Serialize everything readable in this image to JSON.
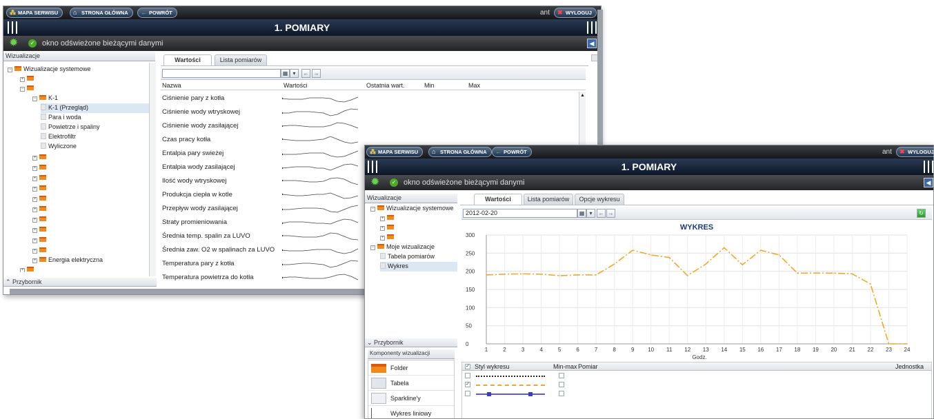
{
  "topnav": {
    "map": "MAPA SERWISU",
    "home": "STRONA GŁÓWNA",
    "back": "POWRÓT",
    "user": "ant",
    "logout": "WYLOGUJ"
  },
  "title": "1. POMIARY",
  "status": "okno odświeżone bieżącymi danymi",
  "left_panel": {
    "header": "Wizualizacje",
    "tree": {
      "system": "Wizualizacje systemowe",
      "k1": "K-1",
      "k1_children": [
        "K-1 (Przegląd)",
        "Para i woda",
        "Powietrze i spaliny",
        "Elektrofiltr",
        "Wyliczone"
      ],
      "energy": "Energia elektryczna",
      "mine": "Moje wizualizacje",
      "mine_children": [
        "Tabela pomiarów",
        "Wykres"
      ]
    },
    "toolbox": "Przybornik",
    "components_header": "Komponenty wizualizacji",
    "components": [
      "Folder",
      "Tabela",
      "Sparkline'y",
      "Wykres liniowy"
    ]
  },
  "tabs": {
    "values": "Wartości",
    "list": "Lista pomiarów",
    "options": "Opcje wykresu"
  },
  "measure_table": {
    "columns": [
      "Nazwa",
      "Wartości",
      "Ostatnia wart.",
      "Min",
      "Max"
    ],
    "rows": [
      "Ciśnienie pary z kotła",
      "Ciśnienie wody wtryskowej",
      "Ciśnienie wody zasilającej",
      "Czas pracy kotła",
      "Entalpia pary swieżej",
      "Entalpia wody zasilającej",
      "Ilość wody wtryskowej",
      "Produkcja ciepła w kotle",
      "Przepływ wody zasilającej",
      "Straty promieniowania",
      "Średnia temp. spalin za LUVO",
      "Średnia zaw. O2 w spalinach za LUVO",
      "Temperatura pary z kotła",
      "Temperatura powietrza do kotła"
    ]
  },
  "date_value": "2012-02-20",
  "chart_data": {
    "type": "line",
    "title": "WYKRES",
    "xlabel": "Godz.",
    "ylabel": "",
    "x": [
      1,
      2,
      3,
      4,
      5,
      6,
      7,
      8,
      9,
      10,
      11,
      12,
      13,
      14,
      15,
      16,
      17,
      18,
      19,
      20,
      21,
      22,
      23,
      24
    ],
    "series": [
      {
        "values": [
          190,
          192,
          193,
          192,
          188,
          190,
          190,
          220,
          258,
          245,
          238,
          188,
          220,
          265,
          218,
          258,
          245,
          195,
          195,
          195,
          193,
          165,
          0,
          0
        ],
        "color": "#f6a623"
      }
    ],
    "ylim": [
      0,
      300
    ],
    "yticks": [
      0,
      50,
      100,
      150,
      200,
      250,
      300
    ],
    "grid": true
  },
  "legend_table": {
    "columns": [
      "Styl wykresu",
      "Min-max",
      "Pomiar",
      "Jednostka"
    ]
  }
}
